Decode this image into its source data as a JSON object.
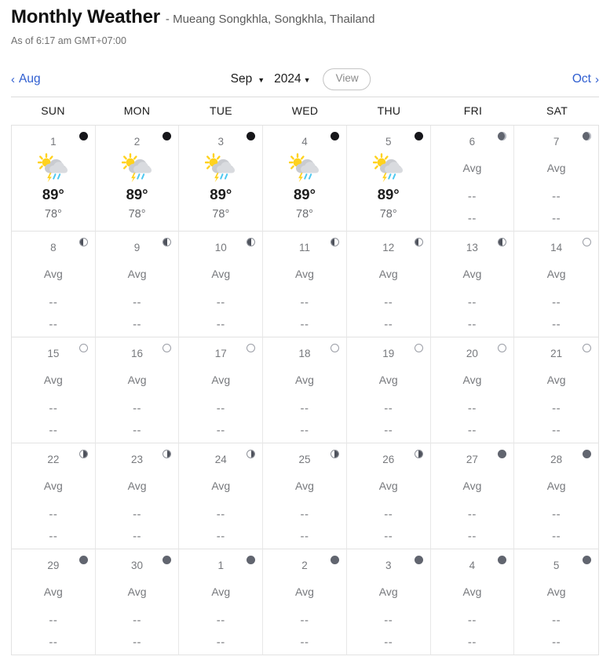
{
  "header": {
    "title": "Monthly Weather",
    "location": "- Mueang Songkhla, Songkhla, Thailand",
    "as_of": "As of 6:17 am GMT+07:00"
  },
  "nav": {
    "prev_month": "Aug",
    "prev_chevron": "‹",
    "next_month": "Oct",
    "next_chevron": "›",
    "month_value": "Sep",
    "year_value": "2024",
    "caret": "▼",
    "view_label": "View",
    "link_color": "#2f5ed0"
  },
  "weekdays": [
    "SUN",
    "MON",
    "TUE",
    "WED",
    "THU",
    "FRI",
    "SAT"
  ],
  "labels": {
    "avg": "Avg",
    "dash": "--"
  },
  "days": [
    {
      "num": "1",
      "moon": "new-dark",
      "icon": "sun-cloud-thunder-rain-icon",
      "hi": "89°",
      "lo": "78°",
      "has_data": true
    },
    {
      "num": "2",
      "moon": "new-dark",
      "icon": "sun-cloud-thunder-rain-icon",
      "hi": "89°",
      "lo": "78°",
      "has_data": true
    },
    {
      "num": "3",
      "moon": "new-dark",
      "icon": "sun-cloud-thunder-rain-icon",
      "hi": "89°",
      "lo": "78°",
      "has_data": true
    },
    {
      "num": "4",
      "moon": "new-dark",
      "icon": "sun-cloud-thunder-rain-icon",
      "hi": "89°",
      "lo": "78°",
      "has_data": true
    },
    {
      "num": "5",
      "moon": "new-dark",
      "icon": "sun-cloud-thunder-rain-icon",
      "hi": "89°",
      "lo": "78°",
      "has_data": true
    },
    {
      "num": "6",
      "moon": "crescent-wax",
      "icon": null,
      "hi": "--",
      "lo": "--",
      "has_data": false
    },
    {
      "num": "7",
      "moon": "crescent-wax",
      "icon": null,
      "hi": "--",
      "lo": "--",
      "has_data": false
    },
    {
      "num": "8",
      "moon": "first-quarter",
      "icon": null,
      "hi": "--",
      "lo": "--",
      "has_data": false
    },
    {
      "num": "9",
      "moon": "first-quarter",
      "icon": null,
      "hi": "--",
      "lo": "--",
      "has_data": false
    },
    {
      "num": "10",
      "moon": "first-quarter",
      "icon": null,
      "hi": "--",
      "lo": "--",
      "has_data": false
    },
    {
      "num": "11",
      "moon": "first-quarter",
      "icon": null,
      "hi": "--",
      "lo": "--",
      "has_data": false
    },
    {
      "num": "12",
      "moon": "first-quarter",
      "icon": null,
      "hi": "--",
      "lo": "--",
      "has_data": false
    },
    {
      "num": "13",
      "moon": "first-quarter",
      "icon": null,
      "hi": "--",
      "lo": "--",
      "has_data": false
    },
    {
      "num": "14",
      "moon": "full",
      "icon": null,
      "hi": "--",
      "lo": "--",
      "has_data": false
    },
    {
      "num": "15",
      "moon": "full",
      "icon": null,
      "hi": "--",
      "lo": "--",
      "has_data": false
    },
    {
      "num": "16",
      "moon": "full",
      "icon": null,
      "hi": "--",
      "lo": "--",
      "has_data": false
    },
    {
      "num": "17",
      "moon": "full",
      "icon": null,
      "hi": "--",
      "lo": "--",
      "has_data": false
    },
    {
      "num": "18",
      "moon": "full",
      "icon": null,
      "hi": "--",
      "lo": "--",
      "has_data": false
    },
    {
      "num": "19",
      "moon": "full",
      "icon": null,
      "hi": "--",
      "lo": "--",
      "has_data": false
    },
    {
      "num": "20",
      "moon": "full",
      "icon": null,
      "hi": "--",
      "lo": "--",
      "has_data": false
    },
    {
      "num": "21",
      "moon": "full",
      "icon": null,
      "hi": "--",
      "lo": "--",
      "has_data": false
    },
    {
      "num": "22",
      "moon": "last-quarter",
      "icon": null,
      "hi": "--",
      "lo": "--",
      "has_data": false
    },
    {
      "num": "23",
      "moon": "last-quarter",
      "icon": null,
      "hi": "--",
      "lo": "--",
      "has_data": false
    },
    {
      "num": "24",
      "moon": "last-quarter",
      "icon": null,
      "hi": "--",
      "lo": "--",
      "has_data": false
    },
    {
      "num": "25",
      "moon": "last-quarter",
      "icon": null,
      "hi": "--",
      "lo": "--",
      "has_data": false
    },
    {
      "num": "26",
      "moon": "last-quarter",
      "icon": null,
      "hi": "--",
      "lo": "--",
      "has_data": false
    },
    {
      "num": "27",
      "moon": "new-gray",
      "icon": null,
      "hi": "--",
      "lo": "--",
      "has_data": false
    },
    {
      "num": "28",
      "moon": "new-gray",
      "icon": null,
      "hi": "--",
      "lo": "--",
      "has_data": false
    },
    {
      "num": "29",
      "moon": "new-gray",
      "icon": null,
      "hi": "--",
      "lo": "--",
      "has_data": false
    },
    {
      "num": "30",
      "moon": "new-gray",
      "icon": null,
      "hi": "--",
      "lo": "--",
      "has_data": false
    },
    {
      "num": "1",
      "moon": "new-gray",
      "icon": null,
      "hi": "--",
      "lo": "--",
      "has_data": false
    },
    {
      "num": "2",
      "moon": "new-gray",
      "icon": null,
      "hi": "--",
      "lo": "--",
      "has_data": false
    },
    {
      "num": "3",
      "moon": "new-gray",
      "icon": null,
      "hi": "--",
      "lo": "--",
      "has_data": false
    },
    {
      "num": "4",
      "moon": "new-gray",
      "icon": null,
      "hi": "--",
      "lo": "--",
      "has_data": false
    },
    {
      "num": "5",
      "moon": "new-gray",
      "icon": null,
      "hi": "--",
      "lo": "--",
      "has_data": false
    }
  ]
}
